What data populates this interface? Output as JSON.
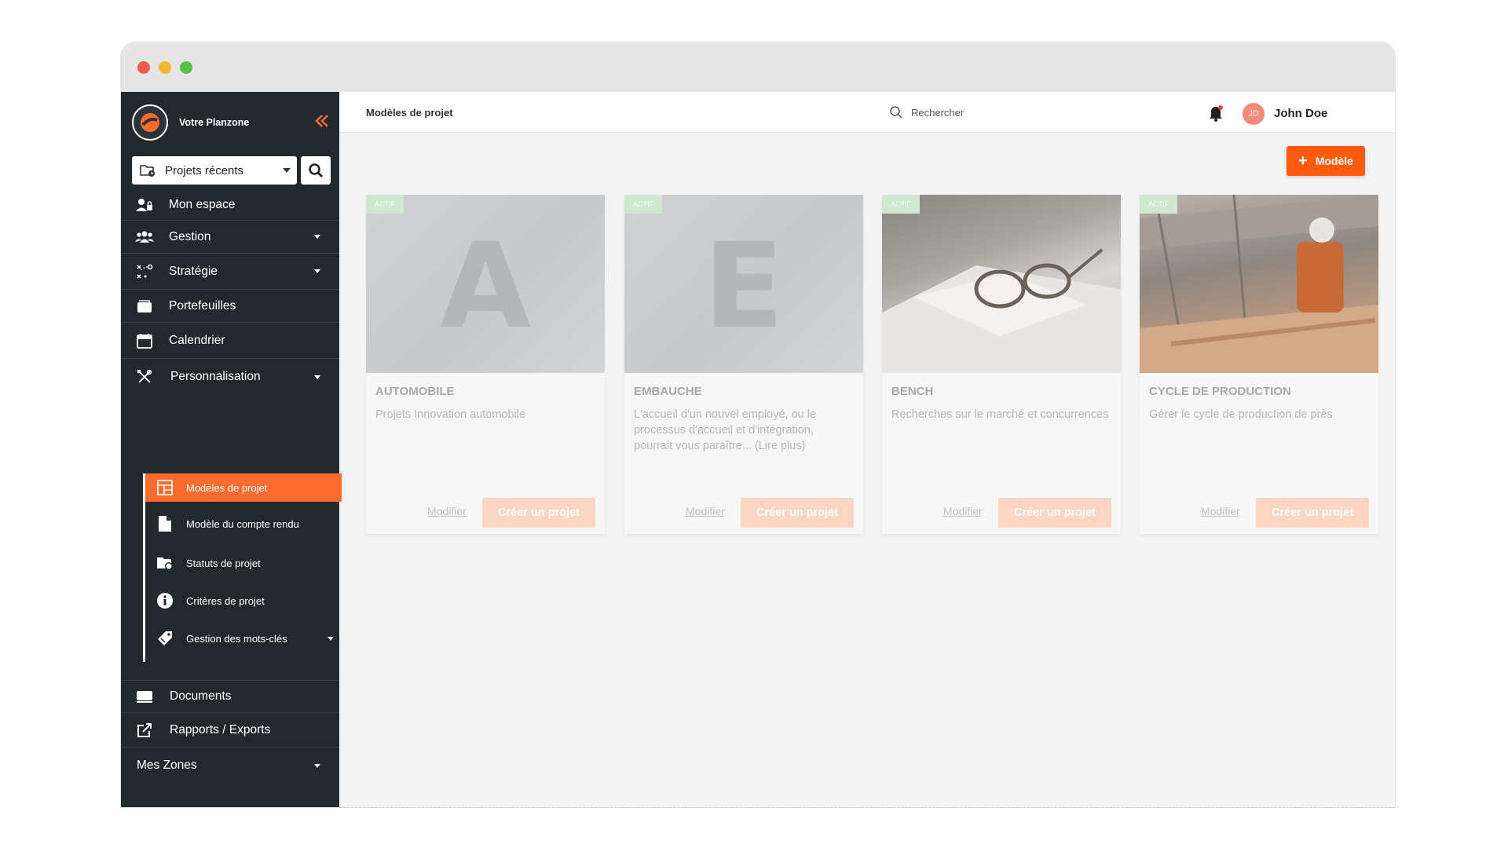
{
  "sidebar": {
    "brand_name": "Votre Planzone",
    "recent_projects": "Projets récents",
    "items": [
      {
        "label": "Mon espace"
      },
      {
        "label": "Gestion"
      },
      {
        "label": "Stratégie"
      },
      {
        "label": "Portefeuilles"
      },
      {
        "label": "Calendrier"
      },
      {
        "label": "Personnalisation"
      },
      {
        "label": "Documents"
      },
      {
        "label": "Rapports / Exports"
      },
      {
        "label": "Mes Zones"
      }
    ],
    "sub_items": [
      {
        "label": "Modèles de projet"
      },
      {
        "label": "Modèle du compte rendu"
      },
      {
        "label": "Statuts de projet"
      },
      {
        "label": "Critères de projet"
      },
      {
        "label": "Gestion des mots-clés"
      }
    ]
  },
  "topbar": {
    "page_title": "Modèles de projet",
    "search_placeholder": "Rechercher",
    "user_initials": "JD",
    "user_name": "John Doe"
  },
  "toolbar": {
    "add_label": "Modèle"
  },
  "cards": [
    {
      "badge": "ACTIF",
      "letter": "A",
      "title": "AUTOMOBILE",
      "desc": "Projets Innovation automobile",
      "modify": "Modifier",
      "create": "Créer un projet"
    },
    {
      "badge": "ACTIF",
      "letter": "E",
      "title": "EMBAUCHE",
      "desc": "L'accueil d'un nouvel employé, ou le processus d'accueil et d'intégration, pourrait vous paraître... (Lire plus)",
      "modify": "Modifier",
      "create": "Créer un projet"
    },
    {
      "badge": "ACTIF",
      "letter": "",
      "title": "BENCH",
      "desc": "Recherches sur le marché et concurrences",
      "modify": "Modifier",
      "create": "Créer un projet"
    },
    {
      "badge": "ACTIF",
      "letter": "",
      "title": "CYCLE DE PRODUCTION",
      "desc": "Gérer le cycle de production de près",
      "modify": "Modifier",
      "create": "Créer un projet"
    }
  ],
  "colors": {
    "accent": "#fe6b2f",
    "sidebar_bg": "#22292d"
  }
}
